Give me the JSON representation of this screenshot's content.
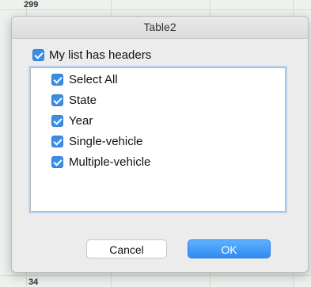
{
  "spreadsheet": {
    "row_top": "299",
    "row_bottom": "34"
  },
  "dialog": {
    "title": "Table2",
    "headers_checkbox": {
      "label": "My list has headers",
      "checked": true
    },
    "list_items": [
      {
        "label": "Select All",
        "checked": true
      },
      {
        "label": "State",
        "checked": true
      },
      {
        "label": "Year",
        "checked": true
      },
      {
        "label": "Single-vehicle",
        "checked": true
      },
      {
        "label": "Multiple-vehicle",
        "checked": true
      }
    ],
    "buttons": {
      "cancel_label": "Cancel",
      "ok_label": "OK"
    }
  },
  "colors": {
    "checkbox": "#3b8ee6",
    "ok_button": "#2f8cf2",
    "focus_ring": "#b7d3f2"
  },
  "icons": [
    "checkmark-icon"
  ]
}
